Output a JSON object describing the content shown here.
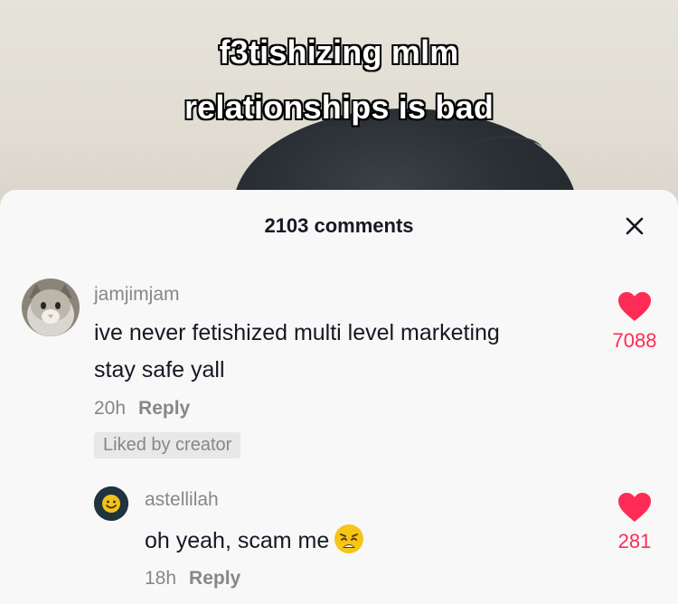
{
  "video": {
    "caption_line1": "f3tishizing mlm",
    "caption_line2": "relationships is bad"
  },
  "comments_panel": {
    "title": "2103 comments",
    "close_icon": "close-icon"
  },
  "comments": [
    {
      "username": "jamjimjam",
      "text_line1": "ive never fetishized multi level marketing",
      "text_line2": "stay safe yall",
      "time": "20h",
      "reply_label": "Reply",
      "badge": "Liked by creator",
      "likes": "7088",
      "avatar_icon": "cat-avatar"
    },
    {
      "username": "astellilah",
      "text": "oh yeah, scam me",
      "emoji": "weary-face-emoji",
      "time": "18h",
      "reply_label": "Reply",
      "likes": "281",
      "avatar_icon": "smiley-avatar"
    }
  ],
  "colors": {
    "like_red": "#fe2c55",
    "sheet_bg": "#f8f8f8",
    "text_primary": "#161823",
    "text_secondary": "#86878b"
  }
}
